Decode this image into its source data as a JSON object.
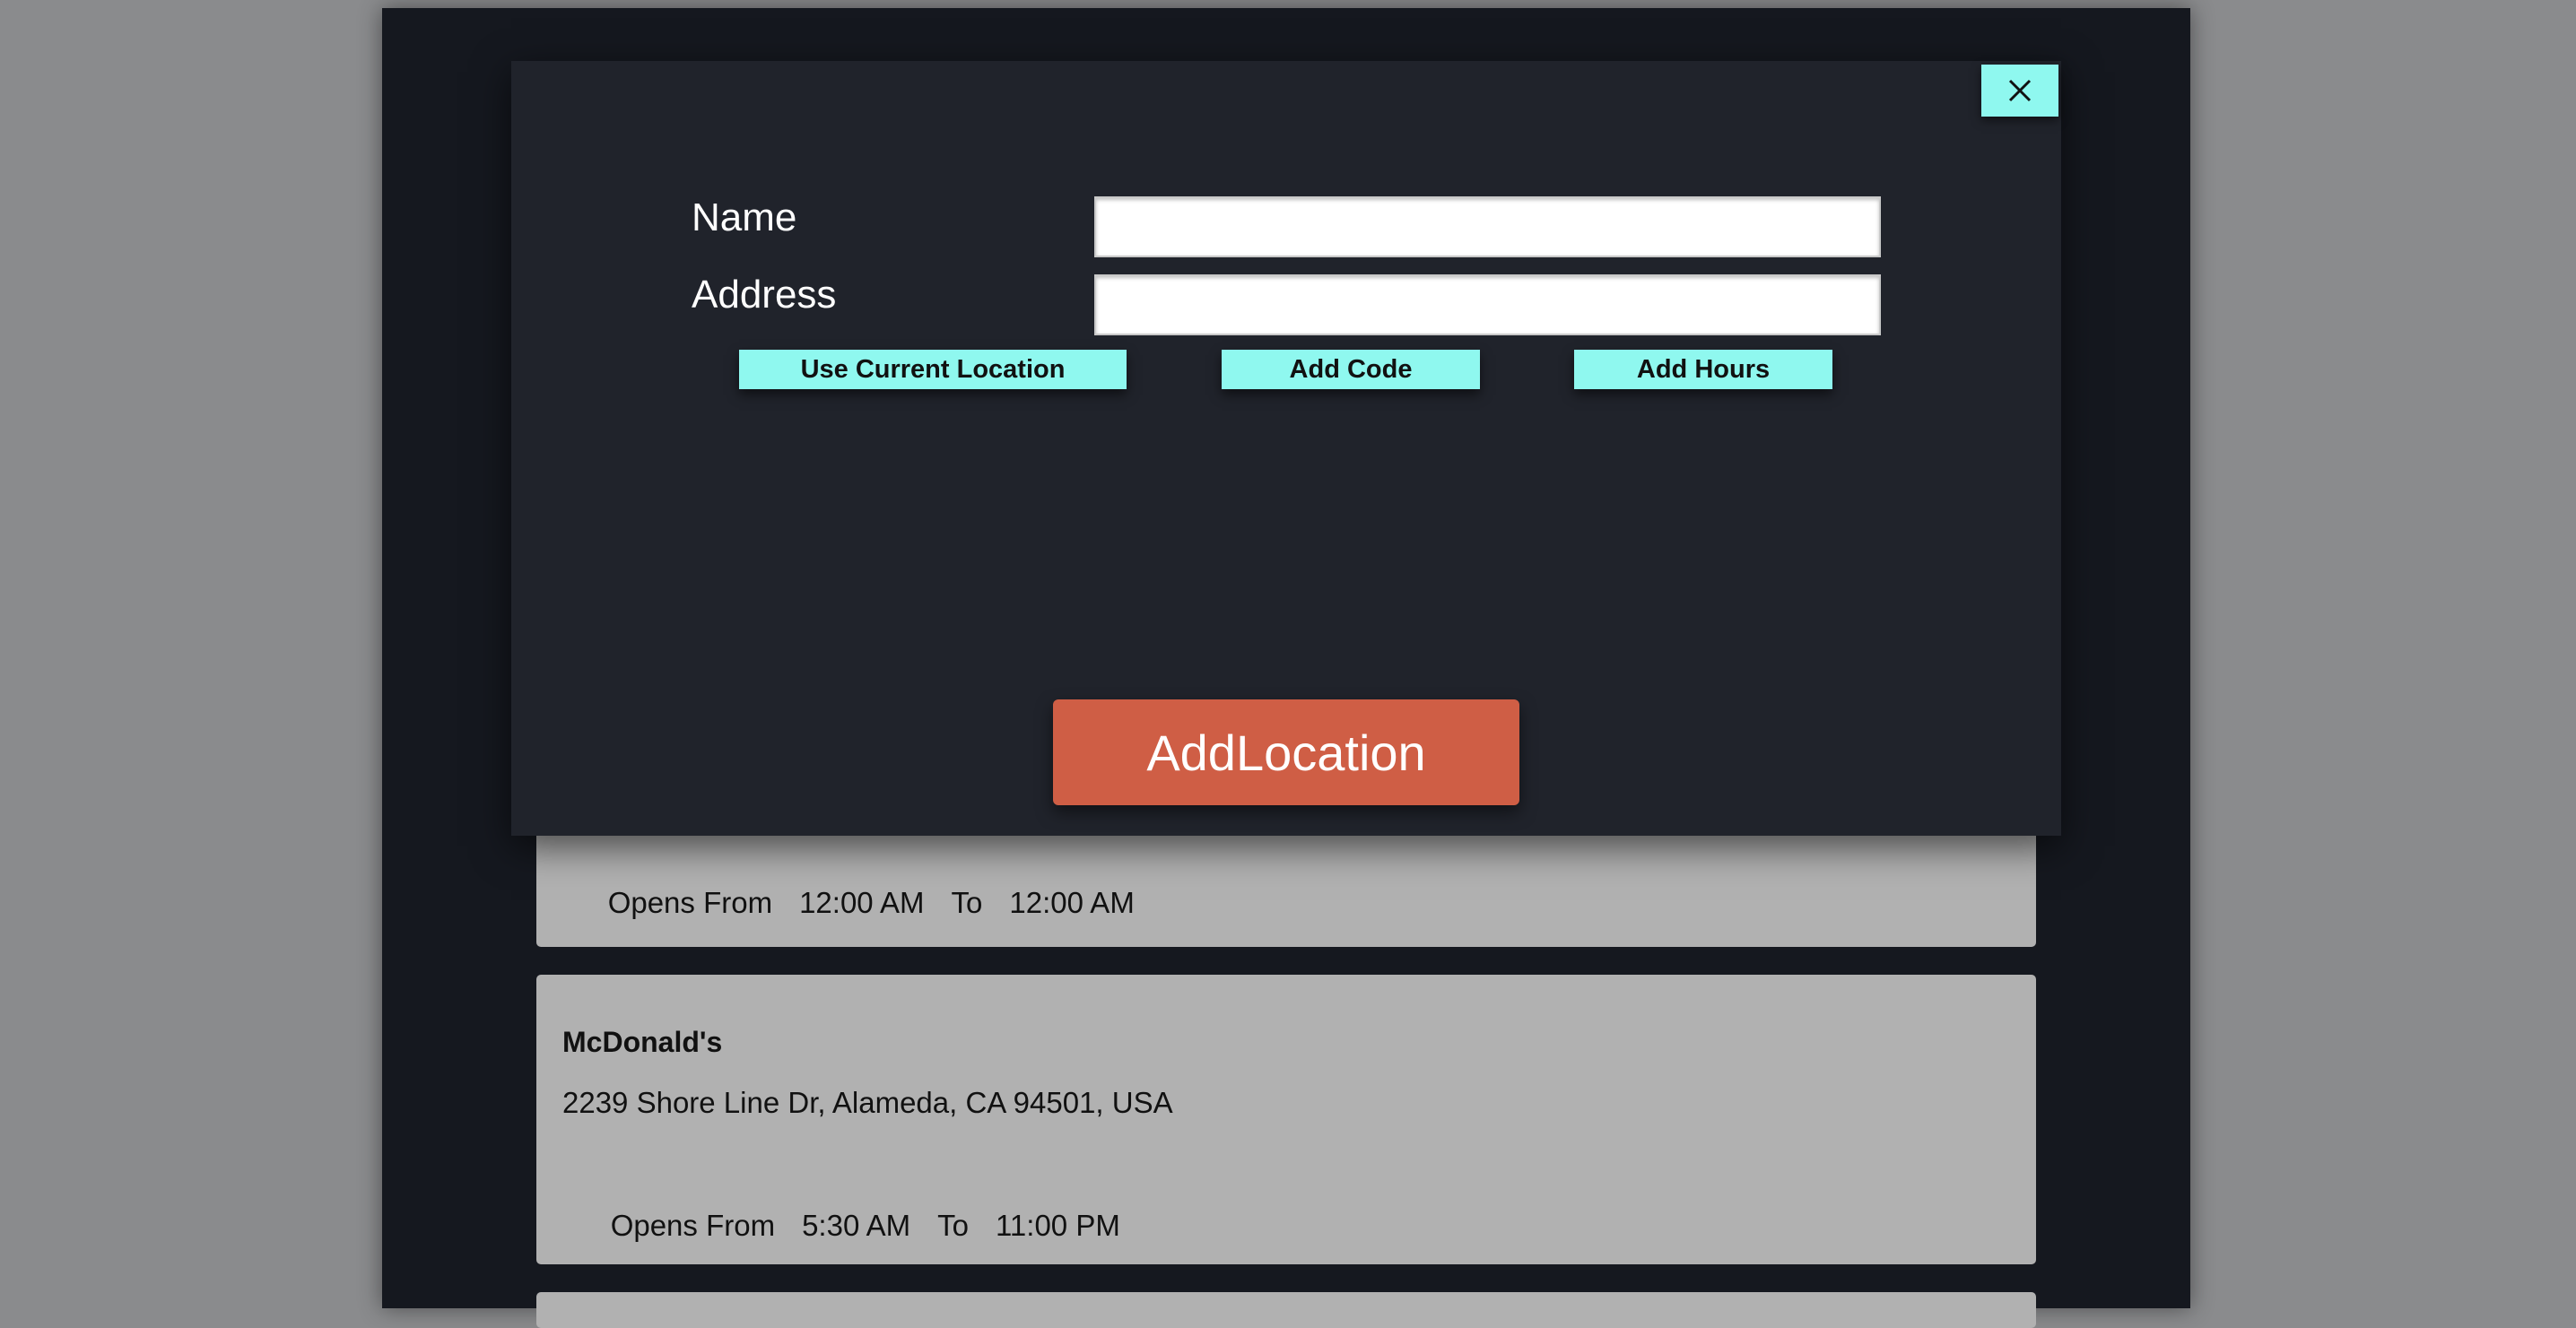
{
  "modal": {
    "close_icon": "close-icon",
    "name_label": "Name",
    "name_value": "",
    "address_label": "Address",
    "address_value": "",
    "buttons": {
      "use_current_location": "Use Current Location",
      "add_code": "Add Code",
      "add_hours": "Add Hours"
    },
    "submit_label": "AddLocation"
  },
  "locations": [
    {
      "name": "",
      "address": "",
      "opens_label": "Opens From",
      "open_time": "12:00 AM",
      "to_label": "To",
      "close_time": "12:00 AM"
    },
    {
      "name": "McDonald's",
      "address": "2239 Shore Line Dr, Alameda, CA 94501, USA",
      "opens_label": "Opens From",
      "open_time": "5:30 AM",
      "to_label": "To",
      "close_time": "11:00 PM"
    }
  ],
  "colors": {
    "backdrop": "#8a8b8d",
    "app_background": "#15181f",
    "modal_background": "#20232b",
    "accent_cyan": "#8ff8ef",
    "primary_button": "#cf5e45",
    "card_background": "#b1b1b1"
  }
}
